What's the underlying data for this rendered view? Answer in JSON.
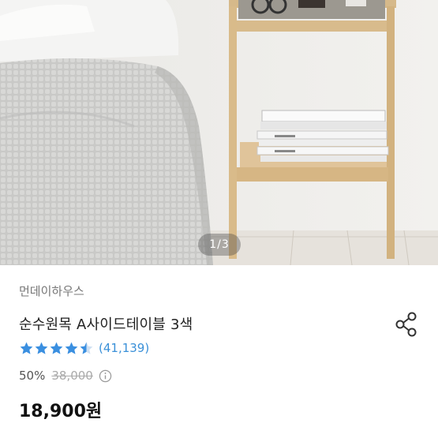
{
  "gallery": {
    "pager_text": "1/3"
  },
  "product": {
    "brand": "먼데이하우스",
    "title": "순수원목 A사이드테이블 3색",
    "rating": {
      "stars": 4.5,
      "count_text": "(41,139)"
    },
    "discount_percent": "50%",
    "original_price": "38,000",
    "price": "18,900원"
  },
  "icons": {
    "share": "share-icon",
    "info": "info-icon",
    "star": "star-icon"
  },
  "colors": {
    "star": "#3a8fe0",
    "review_count": "#3a90d8",
    "price": "#111111"
  }
}
